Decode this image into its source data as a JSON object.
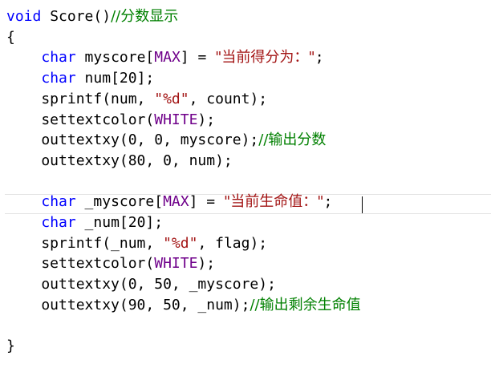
{
  "lines": [
    [
      {
        "t": "void",
        "c": "kw"
      },
      {
        "t": " Score()",
        "c": ""
      },
      {
        "t": "//分数显示",
        "c": "cmt"
      }
    ],
    [
      {
        "t": "{",
        "c": ""
      }
    ],
    [
      {
        "t": "    ",
        "c": ""
      },
      {
        "t": "char",
        "c": "kw"
      },
      {
        "t": " myscore[",
        "c": ""
      },
      {
        "t": "MAX",
        "c": "mac"
      },
      {
        "t": "] = ",
        "c": ""
      },
      {
        "t": "\"当前得分为：\"",
        "c": "str"
      },
      {
        "t": ";",
        "c": ""
      }
    ],
    [
      {
        "t": "    ",
        "c": ""
      },
      {
        "t": "char",
        "c": "kw"
      },
      {
        "t": " num[20];",
        "c": ""
      }
    ],
    [
      {
        "t": "    sprintf(num, ",
        "c": ""
      },
      {
        "t": "\"%d\"",
        "c": "str"
      },
      {
        "t": ", count);",
        "c": ""
      }
    ],
    [
      {
        "t": "    settextcolor(",
        "c": ""
      },
      {
        "t": "WHITE",
        "c": "mac"
      },
      {
        "t": ");",
        "c": ""
      }
    ],
    [
      {
        "t": "    outtextxy(0, 0, myscore);",
        "c": ""
      },
      {
        "t": "//输出分数",
        "c": "cmt"
      }
    ],
    [
      {
        "t": "    outtextxy(80, 0, num);",
        "c": ""
      }
    ],
    [],
    [
      {
        "t": "    ",
        "c": ""
      },
      {
        "t": "char",
        "c": "kw"
      },
      {
        "t": " _myscore[",
        "c": ""
      },
      {
        "t": "MAX",
        "c": "mac"
      },
      {
        "t": "] = ",
        "c": ""
      },
      {
        "t": "\"当前生命值：\"",
        "c": "str"
      },
      {
        "t": ";",
        "c": ""
      }
    ],
    [
      {
        "t": "    ",
        "c": ""
      },
      {
        "t": "char",
        "c": "kw"
      },
      {
        "t": " _num[20];",
        "c": ""
      }
    ],
    [
      {
        "t": "    sprintf(_num, ",
        "c": ""
      },
      {
        "t": "\"%d\"",
        "c": "str"
      },
      {
        "t": ", flag);",
        "c": ""
      }
    ],
    [
      {
        "t": "    settextcolor(",
        "c": ""
      },
      {
        "t": "WHITE",
        "c": "mac"
      },
      {
        "t": ");",
        "c": ""
      }
    ],
    [
      {
        "t": "    outtextxy(0, 50, _myscore);",
        "c": ""
      }
    ],
    [
      {
        "t": "    outtextxy(90, 50, _num);",
        "c": ""
      },
      {
        "t": "//输出剩余生命值",
        "c": "cmt"
      }
    ],
    [],
    [
      {
        "t": "}",
        "c": ""
      }
    ]
  ],
  "colors": {
    "keyword": "#0000ff",
    "string": "#a31515",
    "macro": "#6f008a",
    "comment": "#008000",
    "text": "#000000"
  },
  "cursor_line": 10
}
